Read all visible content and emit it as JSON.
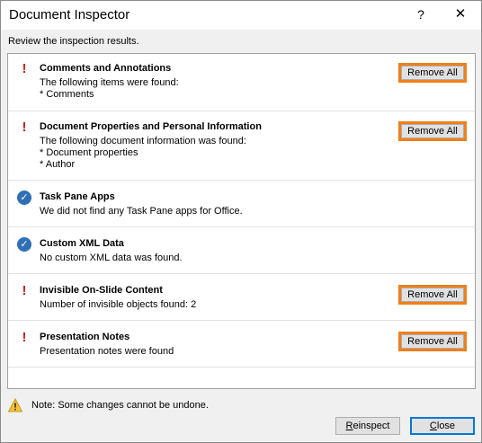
{
  "dialog": {
    "title": "Document Inspector",
    "help_glyph": "?",
    "close_glyph": "✕",
    "intro": "Review the inspection results."
  },
  "results": [
    {
      "status": "found",
      "title": "Comments and Annotations",
      "lines": [
        "The following items were found:",
        "* Comments"
      ],
      "button": "Remove All"
    },
    {
      "status": "found",
      "title": "Document Properties and Personal Information",
      "lines": [
        "The following document information was found:",
        "* Document properties",
        "* Author"
      ],
      "button": "Remove All"
    },
    {
      "status": "clean",
      "title": "Task Pane Apps",
      "lines": [
        "We did not find any Task Pane apps for Office."
      ]
    },
    {
      "status": "clean",
      "title": "Custom XML Data",
      "lines": [
        "No custom XML data was found."
      ]
    },
    {
      "status": "found",
      "title": "Invisible On-Slide Content",
      "lines": [
        "Number of invisible objects found: 2"
      ],
      "button": "Remove All"
    },
    {
      "status": "found",
      "title": "Presentation Notes",
      "lines": [
        "Presentation notes were found"
      ],
      "button": "Remove All"
    }
  ],
  "footer": {
    "note": "Note: Some changes cannot be undone.",
    "reinspect_access_key": "R",
    "reinspect_rest": "einspect",
    "close_access_key": "C",
    "close_rest": "lose"
  },
  "colors": {
    "warning": "#c9211e",
    "check": "#2f6fb5",
    "highlight": "#f07f1b",
    "default_button_border": "#0078d7"
  },
  "icons": {
    "found": "exclamation-icon",
    "clean": "checkmark-icon",
    "note": "warning-triangle-icon"
  }
}
